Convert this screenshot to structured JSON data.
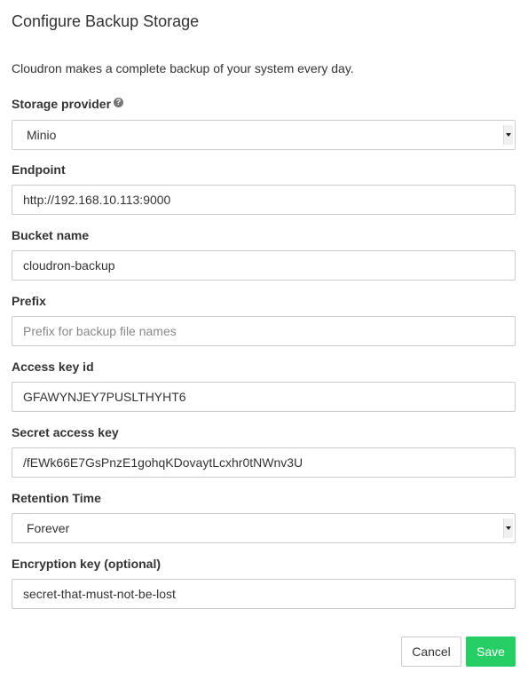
{
  "dialog": {
    "title": "Configure Backup Storage",
    "description": "Cloudron makes a complete backup of your system every day."
  },
  "form": {
    "storage_provider": {
      "label": "Storage provider",
      "help_icon": "question-circle-icon",
      "value": "Minio"
    },
    "endpoint": {
      "label": "Endpoint",
      "value": "http://192.168.10.113:9000"
    },
    "bucket_name": {
      "label": "Bucket name",
      "value": "cloudron-backup"
    },
    "prefix": {
      "label": "Prefix",
      "value": "",
      "placeholder": "Prefix for backup file names"
    },
    "access_key_id": {
      "label": "Access key id",
      "value": "GFAWYNJEY7PUSLTHYHT6"
    },
    "secret_access_key": {
      "label": "Secret access key",
      "value": "/fEWk66E7GsPnzE1gohqKDovaytLcxhr0tNWnv3U"
    },
    "retention_time": {
      "label": "Retention Time",
      "value": "Forever"
    },
    "encryption_key": {
      "label": "Encryption key (optional)",
      "value": "secret-that-must-not-be-lost"
    }
  },
  "footer": {
    "cancel_label": "Cancel",
    "save_label": "Save"
  },
  "colors": {
    "save_button": "#27ce65",
    "text": "#333333",
    "border": "#cccccc",
    "placeholder": "#888888"
  }
}
